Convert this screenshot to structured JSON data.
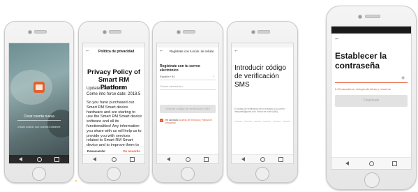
{
  "screens": {
    "welcome": {
      "create_account": "Crear cuenta nueva",
      "login_existing": "Iniciar sesión con cuenta existente"
    },
    "privacy": {
      "header": "Política de privacidad",
      "title": "Privacy Policy of Smart RM Platform",
      "update_date": "Update date:   2018.4",
      "force_date": "Come into force date:   2018.5",
      "body": "So you have purchased our Smart RM Smart device hardware and are starting to use the Smart RM Smart device software and all its functionalities! Any information you share with us will help us to provide you with services related to Smart RM Smart device and to improve them to make them even better. We explain here our ways of collecting and using information, and how we protect",
      "decline": "Desacuerdo",
      "accept": "De acuerdo"
    },
    "register": {
      "header": "Regístrate con tu núm. de celular",
      "subheader": "Regístrate con tu correo electrónico",
      "country": "España +34",
      "email_placeholder": "Correo electrónico",
      "send_button": "Obtener código de verificación SMS",
      "agree_prefix": "He acordado",
      "agree_link": "Acuerdo de Servicios | Política de privacidad"
    },
    "sms": {
      "title": "Introducir código de verificación SMS",
      "sent_text": "El código de verificación se ha enviado a su correo: ",
      "sent_email": "dtmpanel@gmail.com",
      "resend": "Enviar de nuevo(55s)"
    },
    "password": {
      "title": "Establecer la contraseña",
      "hint": "6-20 caracteres, incluyendo letras y números",
      "finish": "Finalizado"
    }
  }
}
